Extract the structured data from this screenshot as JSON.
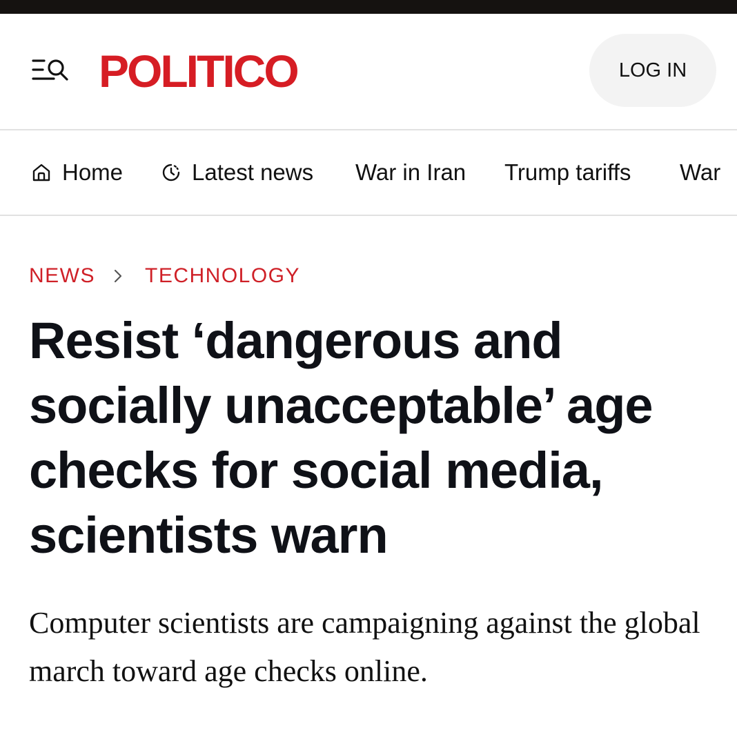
{
  "header": {
    "menu_search_icon": "menu-search-icon",
    "logo_text": "POLITICO",
    "login_label": "LOG IN",
    "brand_color": "#d61d24"
  },
  "nav": {
    "items": [
      {
        "label": "Home",
        "icon": "home-icon"
      },
      {
        "label": "Latest news",
        "icon": "clock-icon"
      },
      {
        "label": "War in Iran"
      },
      {
        "label": "Trump tariffs"
      },
      {
        "label": "War"
      }
    ]
  },
  "breadcrumb": {
    "items": [
      "NEWS",
      "TECHNOLOGY"
    ],
    "separator_icon": "chevron-right-icon"
  },
  "article": {
    "headline": "Resist ‘dangerous and socially unacceptable’ age checks for social media, scientists warn",
    "dek": "Computer scientists are campaigning against the global march toward age checks online."
  }
}
